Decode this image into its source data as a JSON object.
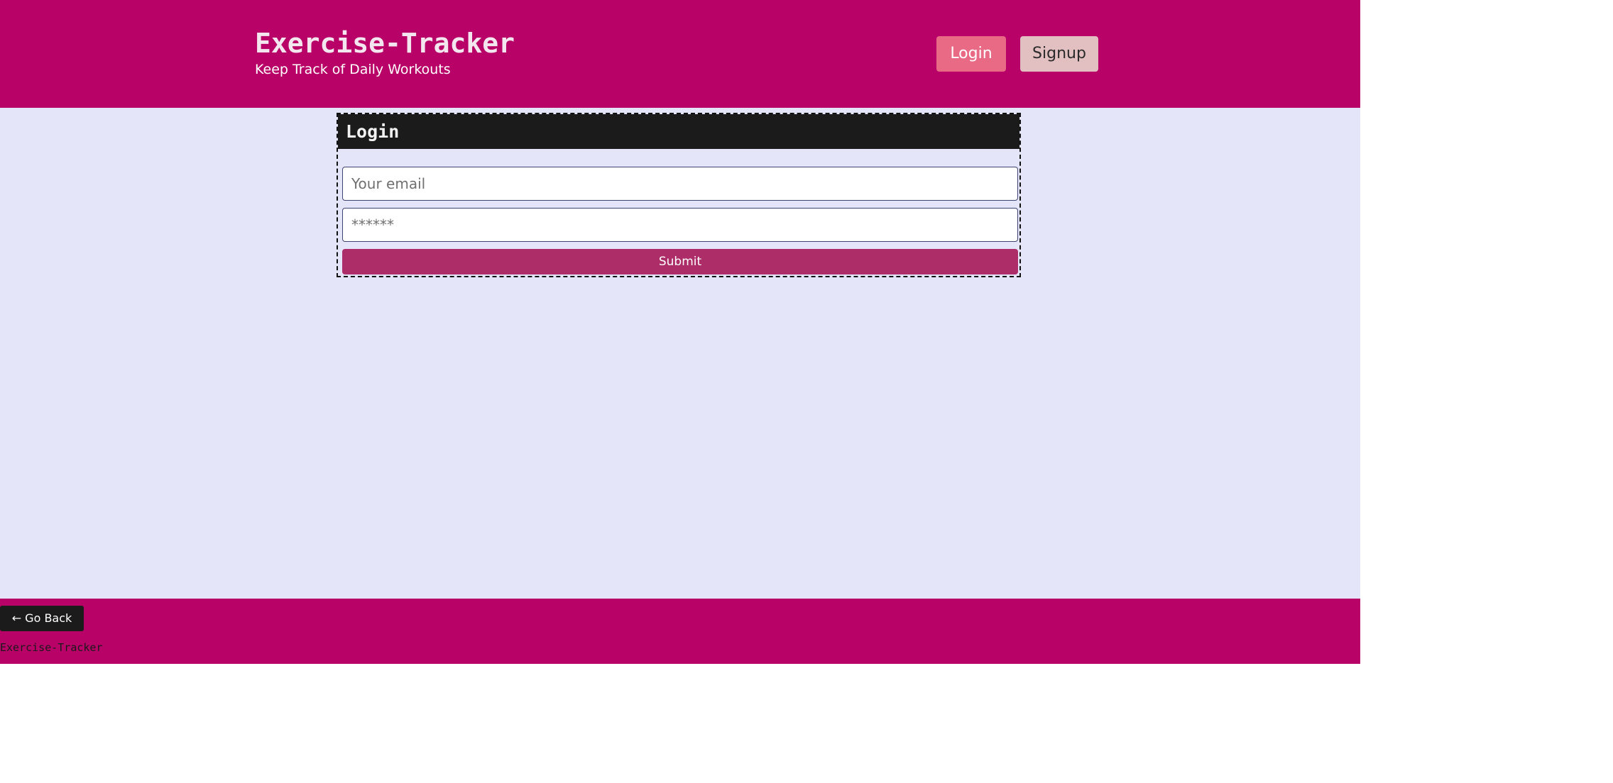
{
  "header": {
    "title": "Exercise-Tracker",
    "tagline": "Keep Track of Daily Workouts",
    "login_label": "Login",
    "signup_label": "Signup"
  },
  "login_form": {
    "title": "Login",
    "email_placeholder": "Your email",
    "password_placeholder": "******",
    "submit_label": "Submit"
  },
  "footer": {
    "go_back_label": "← Go Back",
    "brand": "Exercise-Tracker"
  },
  "colors": {
    "brand": "#b80267",
    "content_bg": "#e5e5f9",
    "login_button": "#e86a85",
    "signup_button": "#e2bfc0",
    "submit_button": "#ad2d68",
    "dark": "#1b1b1b"
  }
}
